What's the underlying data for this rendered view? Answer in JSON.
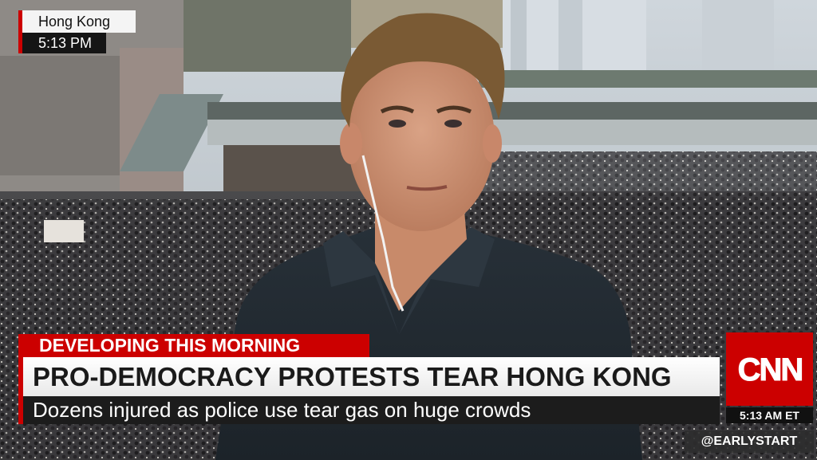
{
  "location": {
    "city": "Hong Kong",
    "time": "5:13 PM"
  },
  "lower_third": {
    "kicker": "DEVELOPING THIS MORNING",
    "headline": "PRO-DEMOCRACY PROTESTS TEAR HONG KONG",
    "subheadline": "Dozens injured as police use tear gas on huge crowds"
  },
  "network": {
    "logo_text": "CNN",
    "clock": "5:13 AM ET"
  },
  "social": {
    "handle": "@EARLYSTART"
  },
  "colors": {
    "accent": "#cc0000",
    "headline_bg": "#ffffff",
    "sub_bg": "#1c1c1c"
  }
}
